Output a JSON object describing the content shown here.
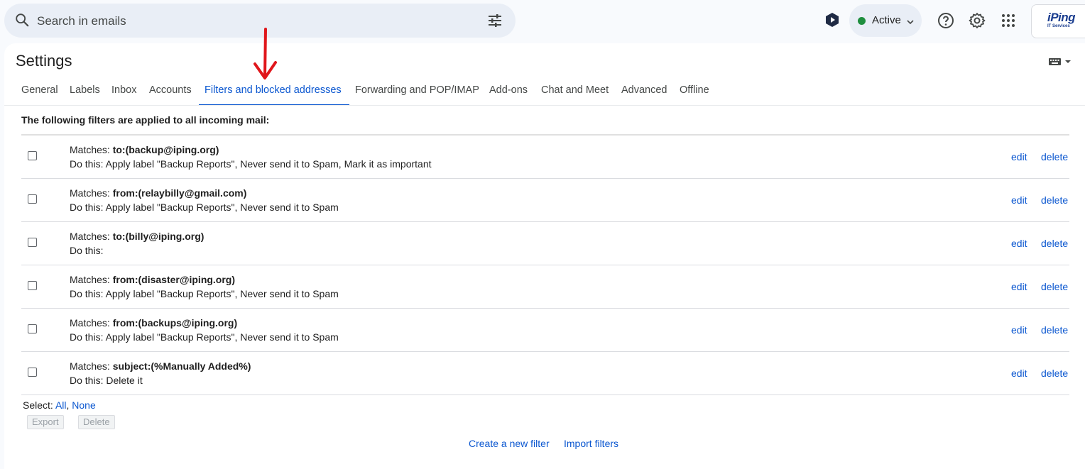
{
  "search": {
    "placeholder": "Search in emails"
  },
  "status": {
    "label": "Active",
    "color": "#1e8e3e"
  },
  "account_logo": {
    "text": "iPing",
    "subtext": "IT Services"
  },
  "page_title": "Settings",
  "tabs": [
    {
      "label": "General"
    },
    {
      "label": "Labels"
    },
    {
      "label": "Inbox"
    },
    {
      "label": "Accounts"
    },
    {
      "label": "Filters and blocked addresses",
      "active": true
    },
    {
      "label": "Forwarding and POP/IMAP"
    },
    {
      "label": "Add-ons"
    },
    {
      "label": "Chat and Meet"
    },
    {
      "label": "Advanced"
    },
    {
      "label": "Offline"
    }
  ],
  "filters": {
    "intro": "The following filters are applied to all incoming mail:",
    "matches_prefix": "Matches: ",
    "edit_label": "edit",
    "delete_label": "delete",
    "rows": [
      {
        "criteria": "to:(backup@iping.org)",
        "action": "Do this: Apply label \"Backup Reports\", Never send it to Spam, Mark it as important"
      },
      {
        "criteria": "from:(relaybilly@gmail.com)",
        "action": "Do this: Apply label \"Backup Reports\", Never send it to Spam"
      },
      {
        "criteria": "to:(billy@iping.org)",
        "action": "Do this:"
      },
      {
        "criteria": "from:(disaster@iping.org)",
        "action": "Do this: Apply label \"Backup Reports\", Never send it to Spam"
      },
      {
        "criteria": "from:(backups@iping.org)",
        "action": "Do this: Apply label \"Backup Reports\", Never send it to Spam"
      },
      {
        "criteria": "subject:(%Manually Added%)",
        "action": "Do this: Delete it"
      }
    ]
  },
  "select": {
    "prefix": "Select:",
    "all": "All",
    "sep": ",",
    "none": "None"
  },
  "buttons": {
    "export": "Export",
    "delete": "Delete"
  },
  "links": {
    "create_filter": "Create a new filter",
    "import_filters": "Import filters"
  },
  "colors": {
    "accent": "#0b57d0",
    "annotation": "#e0161b"
  }
}
